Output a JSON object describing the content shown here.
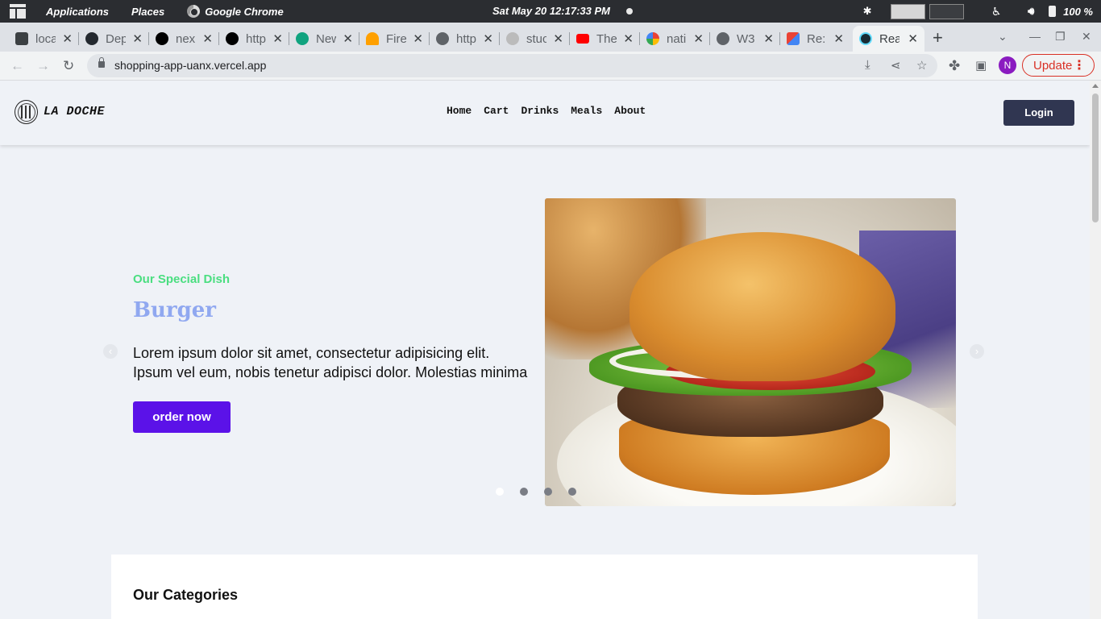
{
  "os_panel": {
    "applications": "Applications",
    "places": "Places",
    "active_app": "Google Chrome",
    "clock": "Sat May 20  12:17:33 PM",
    "battery": "100 %"
  },
  "browser": {
    "tabs": [
      {
        "title": "loca",
        "favicon_color": "#3c4043"
      },
      {
        "title": "Dep",
        "favicon_color": "#24292f"
      },
      {
        "title": "nex",
        "favicon_color": "#000000"
      },
      {
        "title": "http",
        "favicon_color": "#000000"
      },
      {
        "title": "New",
        "favicon_color": "#10a37f"
      },
      {
        "title": "Fire",
        "favicon_color": "#ffa000"
      },
      {
        "title": "http",
        "favicon_color": "#5f6368"
      },
      {
        "title": "stuc",
        "favicon_color": "#888888"
      },
      {
        "title": "The",
        "favicon_color": "#ff0000"
      },
      {
        "title": "nati",
        "favicon_color": "#4285f4"
      },
      {
        "title": "W3",
        "favicon_color": "#5f6368"
      },
      {
        "title": "Re:",
        "favicon_color": "#ea4335"
      },
      {
        "title": "Rea",
        "favicon_color": "#1a2b34"
      }
    ],
    "url": "shopping-app-uanx.vercel.app",
    "profile_initial": "N",
    "update_label": "Update"
  },
  "site": {
    "brand": "LA DOCHE",
    "nav": [
      "Home",
      "Cart",
      "Drinks",
      "Meals",
      "About"
    ],
    "login_label": "Login",
    "hero": {
      "eyebrow": "Our Special Dish",
      "title": "Burger",
      "description": "Lorem ipsum dolor sit amet, consectetur adipisicing elit. Ipsum vel eum, nobis tenetur adipisci dolor. Molestias minima",
      "cta": "order now",
      "slide_count": 4,
      "active_slide": 1
    },
    "categories_title": "Our Categories"
  },
  "colors": {
    "accent_green": "#4ade80",
    "title_blue": "#90a8f0",
    "cta_purple": "#5b12e8",
    "login_navy": "#303651"
  }
}
